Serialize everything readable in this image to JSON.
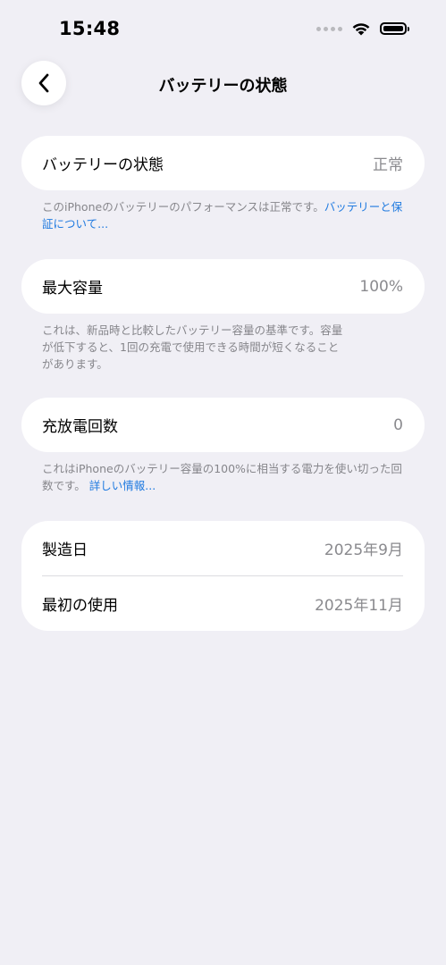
{
  "status_bar": {
    "time": "15:48"
  },
  "nav": {
    "title": "バッテリーの状態"
  },
  "battery_health": {
    "label": "バッテリーの状態",
    "value": "正常",
    "footnote_text": "このiPhoneのバッテリーのパフォーマンスは正常です。",
    "footnote_link": "バッテリーと保証について..."
  },
  "max_capacity": {
    "label": "最大容量",
    "value": "100%",
    "footnote_line1": "これは、新品時と比較したバッテリー容量の基準です。容量",
    "footnote_line2": "が低下すると、1回の充電で使用できる時間が短くなること",
    "footnote_line3": "があります。"
  },
  "cycle_count": {
    "label": "充放電回数",
    "value": "0",
    "footnote_text": "これはiPhoneのバッテリー容量の100%に相当する電力を使い切った回数です。",
    "footnote_link": "詳しい情報..."
  },
  "dates": {
    "manufacture_label": "製造日",
    "manufacture_value": "2025年9月",
    "first_use_label": "最初の使用",
    "first_use_value": "2025年11月"
  },
  "colors": {
    "background": "#f0eff5",
    "link": "#1f7ae0",
    "secondary": "#8a8a8e"
  }
}
